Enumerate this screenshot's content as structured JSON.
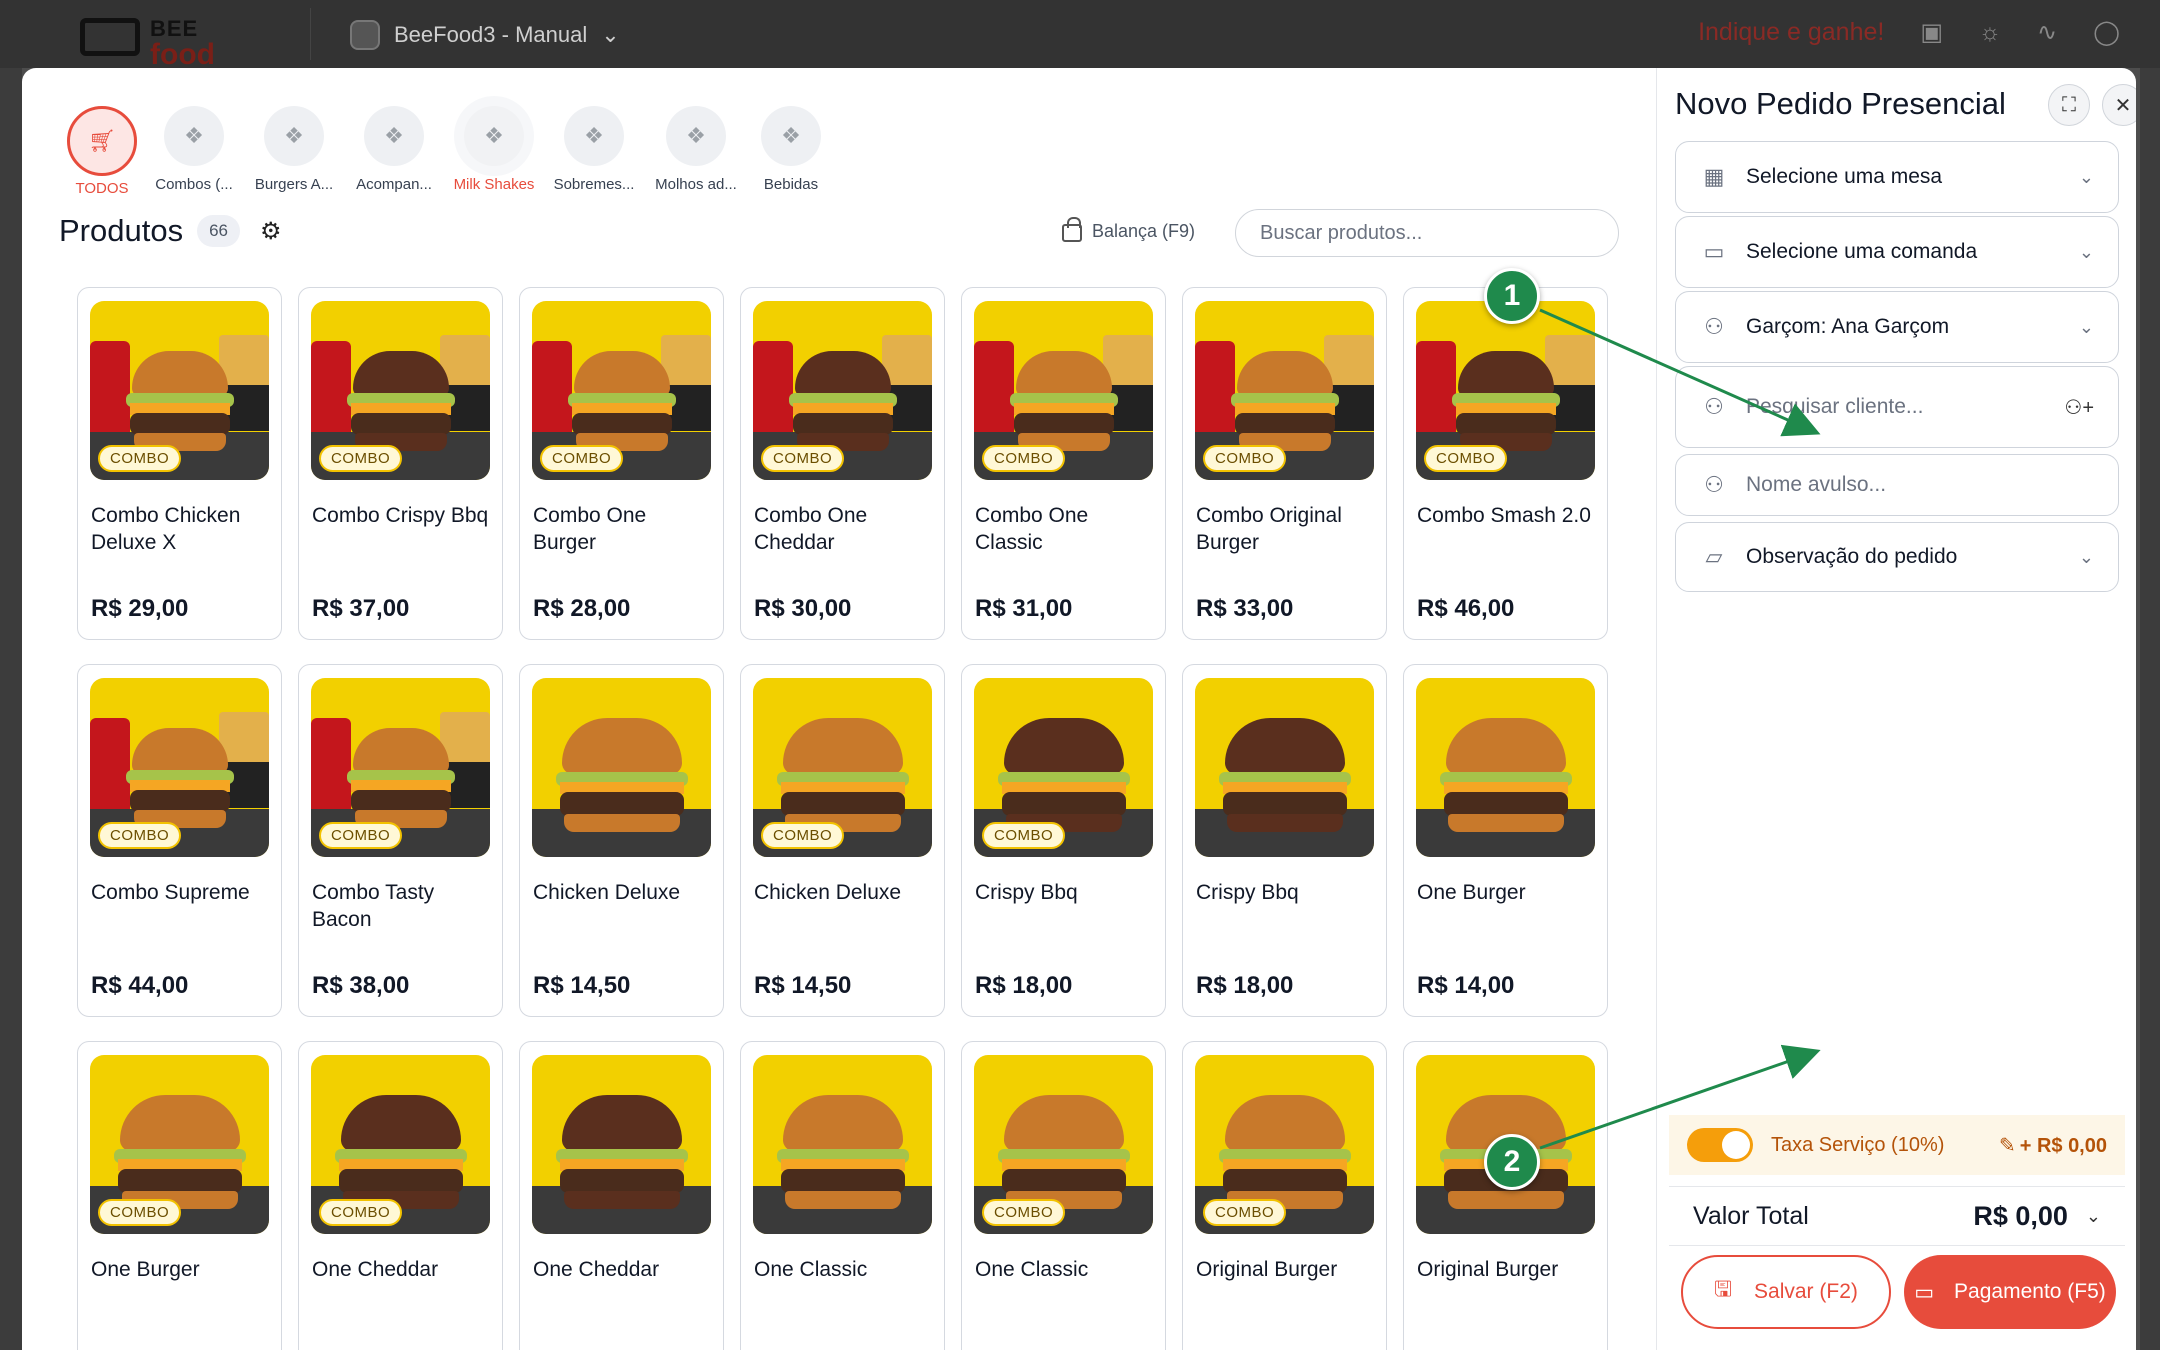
{
  "background": {
    "logo_top": "BEE",
    "logo_bottom": "food",
    "app_name": "BeeFood3 - Manual",
    "indique": "Indique e ganhe!"
  },
  "categories": [
    {
      "label": "TODOS",
      "icon": "cart-icon"
    },
    {
      "label": "Combos (...",
      "icon": "placeholder-icon"
    },
    {
      "label": "Burgers A...",
      "icon": "placeholder-icon"
    },
    {
      "label": "Acompan...",
      "icon": "placeholder-icon"
    },
    {
      "label": "Milk Shakes",
      "icon": "placeholder-icon"
    },
    {
      "label": "Sobremes...",
      "icon": "placeholder-icon"
    },
    {
      "label": "Molhos ad...",
      "icon": "placeholder-icon"
    },
    {
      "label": "Bebidas",
      "icon": "placeholder-icon"
    }
  ],
  "products_header": {
    "title": "Produtos",
    "count": "66",
    "balanca": "Balança (F9)",
    "search_placeholder": "Buscar produtos..."
  },
  "products": [
    {
      "name": "Combo Chicken Deluxe X",
      "price": "R$ 29,00",
      "tag": "COMBO"
    },
    {
      "name": "Combo Crispy Bbq",
      "price": "R$ 37,00",
      "tag": "COMBO"
    },
    {
      "name": "Combo One Burger",
      "price": "R$ 28,00",
      "tag": "COMBO"
    },
    {
      "name": "Combo One Cheddar",
      "price": "R$ 30,00",
      "tag": "COMBO"
    },
    {
      "name": "Combo One Classic",
      "price": "R$ 31,00",
      "tag": "COMBO"
    },
    {
      "name": "Combo Original Burger",
      "price": "R$ 33,00",
      "tag": "COMBO"
    },
    {
      "name": "Combo Smash 2.0",
      "price": "R$ 46,00",
      "tag": "COMBO"
    },
    {
      "name": "Combo Supreme",
      "price": "R$ 44,00",
      "tag": "COMBO"
    },
    {
      "name": "Combo Tasty Bacon",
      "price": "R$ 38,00",
      "tag": "COMBO"
    },
    {
      "name": "Chicken Deluxe",
      "price": "R$ 14,50",
      "tag": ""
    },
    {
      "name": "Chicken Deluxe",
      "price": "R$ 14,50",
      "tag": "COMBO"
    },
    {
      "name": "Crispy Bbq",
      "price": "R$ 18,00",
      "tag": "COMBO"
    },
    {
      "name": "Crispy Bbq",
      "price": "R$ 18,00",
      "tag": ""
    },
    {
      "name": "One Burger",
      "price": "R$ 14,00",
      "tag": ""
    },
    {
      "name": "One Burger",
      "price": "",
      "tag": "COMBO"
    },
    {
      "name": "One Cheddar",
      "price": "",
      "tag": "COMBO"
    },
    {
      "name": "One Cheddar",
      "price": "",
      "tag": ""
    },
    {
      "name": "One Classic",
      "price": "",
      "tag": ""
    },
    {
      "name": "One Classic",
      "price": "",
      "tag": "COMBO"
    },
    {
      "name": "Original Burger",
      "price": "",
      "tag": "COMBO"
    },
    {
      "name": "Original Burger",
      "price": "",
      "tag": ""
    }
  ],
  "order": {
    "title": "Novo Pedido Presencial",
    "mesa": "Selecione uma mesa",
    "comanda": "Selecione uma comanda",
    "garcom": "Garçom: Ana Garçom",
    "cliente_placeholder": "Pesquisar cliente...",
    "avulso_placeholder": "Nome avulso...",
    "observacao": "Observação do pedido",
    "taxa_label": "Taxa Serviço (10%)",
    "taxa_value": "+ R$ 0,00",
    "taxa_enabled": true,
    "total_label": "Valor Total",
    "total_value": "R$ 0,00",
    "save_label": "Salvar (F2)",
    "pay_label": "Pagamento (F5)"
  },
  "annotations": [
    {
      "label": "1"
    },
    {
      "label": "2"
    }
  ],
  "colors": {
    "accent": "#e74c3c",
    "marker": "#1f8a4c",
    "combo_tag_border": "#f2c200",
    "taxa_text": "#b45309"
  }
}
